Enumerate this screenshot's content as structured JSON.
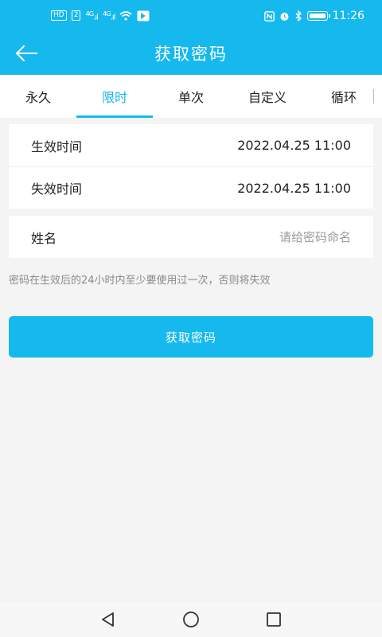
{
  "status_bar": {
    "hd_badge": "HD",
    "net1": "4G",
    "net2": "4G",
    "time": "11:26"
  },
  "header": {
    "title": "获取密码"
  },
  "tabs": [
    {
      "label": "永久"
    },
    {
      "label": "限时"
    },
    {
      "label": "单次"
    },
    {
      "label": "自定义"
    },
    {
      "label": "循环"
    }
  ],
  "form": {
    "start": {
      "label": "生效时间",
      "value": "2022.04.25 11:00"
    },
    "end": {
      "label": "失效时间",
      "value": "2022.04.25 11:00"
    },
    "name": {
      "label": "姓名",
      "placeholder": "请给密码命名"
    }
  },
  "note": "密码在生效后的24小时内至少要使用过一次，否则将失效",
  "button": {
    "label": "获取密码"
  },
  "colors": {
    "accent": "#15b9ee"
  },
  "icons": {
    "back": "back-arrow-icon",
    "nav_back": "triangle-back-icon",
    "nav_home": "circle-home-icon",
    "nav_recent": "square-recent-icon"
  }
}
